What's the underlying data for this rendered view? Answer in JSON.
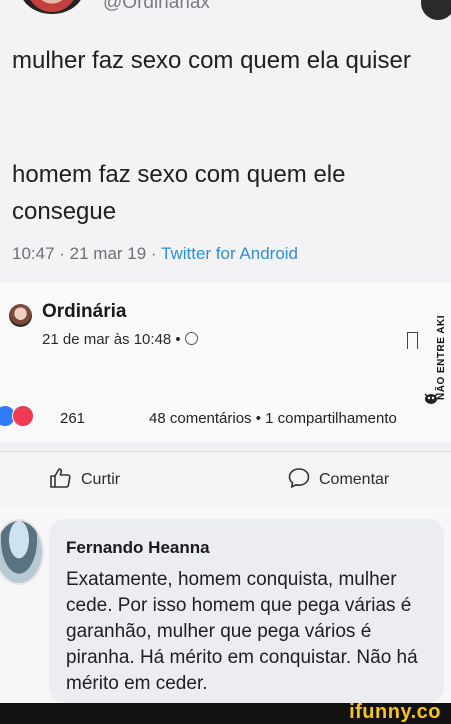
{
  "tweet": {
    "handle": "@Ordinariax",
    "line1": "mulher faz sexo com quem ela quiser",
    "line2": "homem faz sexo com quem ele consegue",
    "timestamp": "10:47 · 21 mar 19 · ",
    "source": "Twitter for Android"
  },
  "post": {
    "page_name": "Ordinária",
    "time": "21 de mar às 10:48 •",
    "reaction_count": "261",
    "comments_shares": "48 comentários • 1 compartilhamento",
    "watermark": "NÃO ENTRE AKI"
  },
  "actions": {
    "like_label": "Curtir",
    "comment_label": "Comentar"
  },
  "comment": {
    "author": "Fernando Heanna",
    "text": "Exatamente, homem conquista, mulher cede. Por isso homem que pega várias é garanhão, mulher que pega vários é piranha. Há mérito em conquistar. Não há mérito em ceder."
  },
  "footer": {
    "logo": "ifunny.co"
  },
  "colors": {
    "link_blue": "#2d8fd8",
    "like_blue": "#2f7cf6",
    "love_red": "#ee3b53",
    "ifunny_yellow": "#f3c51c"
  }
}
